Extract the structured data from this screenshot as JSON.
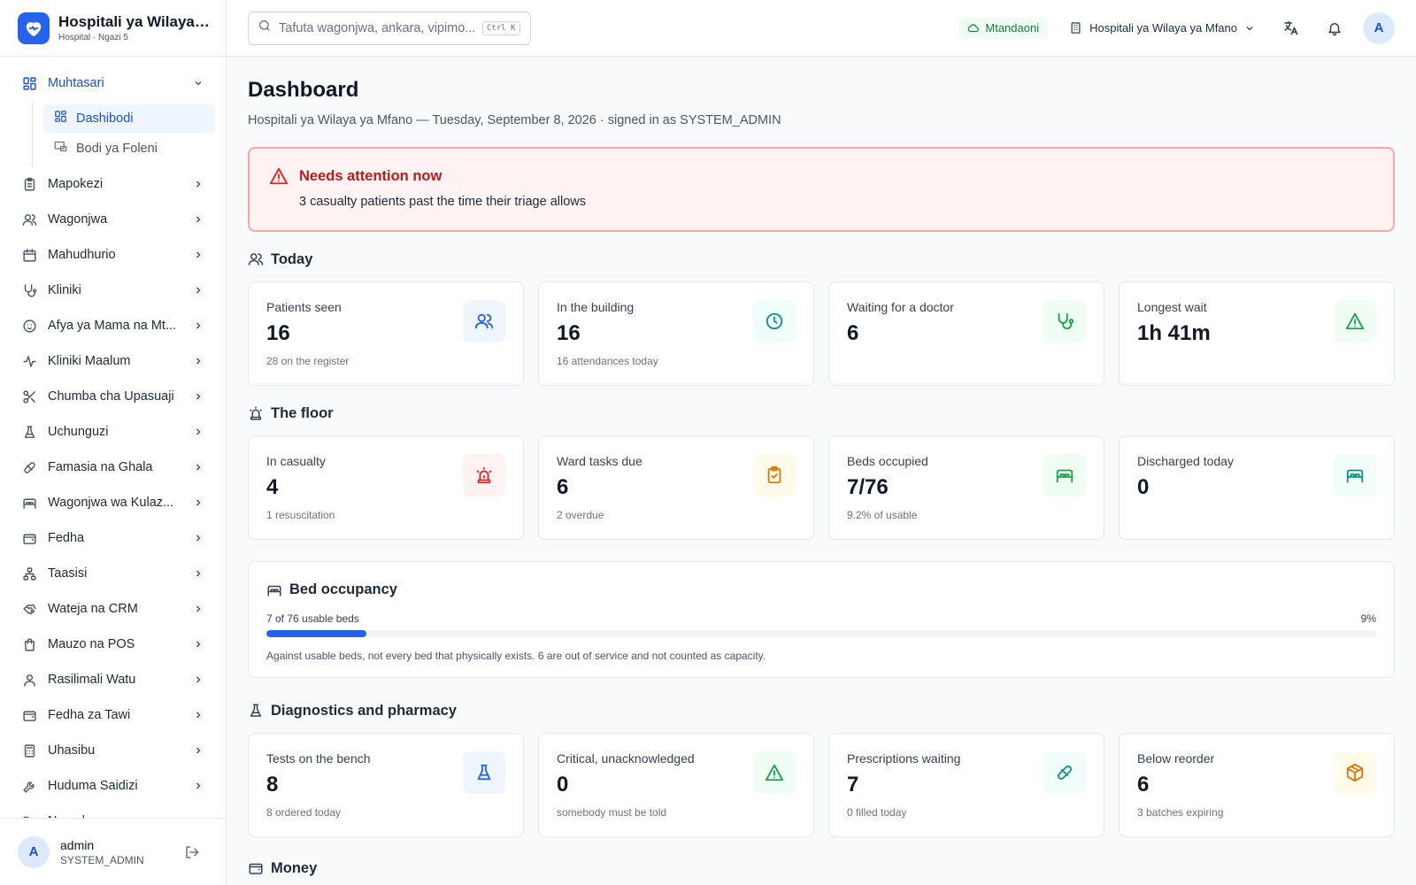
{
  "brand": {
    "name": "Hospitali ya Wilaya ...",
    "sub": "Hospital · Ngazi 5"
  },
  "nav": {
    "open_group": "Muhtasari",
    "sub_items": [
      {
        "label": "Dashibodi",
        "icon": "dashboard-icon"
      },
      {
        "label": "Bodi ya Foleni",
        "icon": "queue-board-icon"
      }
    ],
    "items": [
      {
        "label": "Mapokezi",
        "icon": "clipboard-icon"
      },
      {
        "label": "Wagonjwa",
        "icon": "users-icon"
      },
      {
        "label": "Mahudhurio",
        "icon": "calendar-icon"
      },
      {
        "label": "Kliniki",
        "icon": "stethoscope-icon"
      },
      {
        "label": "Afya ya Mama na Mt...",
        "icon": "baby-icon"
      },
      {
        "label": "Kliniki Maalum",
        "icon": "activity-icon"
      },
      {
        "label": "Chumba cha Upasuaji",
        "icon": "scissors-icon"
      },
      {
        "label": "Uchunguzi",
        "icon": "flask-icon"
      },
      {
        "label": "Famasia na Ghala",
        "icon": "pill-icon"
      },
      {
        "label": "Wagonjwa wa Kulaz...",
        "icon": "bed-icon"
      },
      {
        "label": "Fedha",
        "icon": "wallet-icon"
      },
      {
        "label": "Taasisi",
        "icon": "org-icon"
      },
      {
        "label": "Wateja na CRM",
        "icon": "handshake-icon"
      },
      {
        "label": "Mauzo na POS",
        "icon": "shopping-bag-icon"
      },
      {
        "label": "Rasilimali Watu",
        "icon": "user-icon"
      },
      {
        "label": "Fedha za Tawi",
        "icon": "wallet-icon"
      },
      {
        "label": "Uhasibu",
        "icon": "calculator-icon"
      },
      {
        "label": "Huduma Saidizi",
        "icon": "wrench-icon"
      },
      {
        "label": "Nyaraka",
        "icon": "folder-icon"
      }
    ]
  },
  "user": {
    "initial": "A",
    "name": "admin",
    "role": "SYSTEM_ADMIN"
  },
  "topbar": {
    "search_placeholder": "Tafuta wagonjwa, ankara, vipimo...",
    "shortcut": "Ctrl K",
    "status": "Mtandaoni",
    "facility": "Hospitali ya Wilaya ya Mfano",
    "avatar_initial": "A"
  },
  "page": {
    "title": "Dashboard",
    "subtitle": "Hospitali ya Wilaya ya Mfano — Tuesday, September 8, 2026 · signed in as SYSTEM_ADMIN"
  },
  "alert": {
    "title": "Needs attention now",
    "text": "3 casualty patients past the time their triage allows"
  },
  "sections": {
    "today": {
      "title": "Today",
      "cards": [
        {
          "label": "Patients seen",
          "value": "16",
          "note": "28 on the register",
          "icon": "users-icon",
          "color": "#2563eb",
          "bg": "#eff6ff"
        },
        {
          "label": "In the building",
          "value": "16",
          "note": "16 attendances today",
          "icon": "clock-icon",
          "color": "#0d9488",
          "bg": "#f0fdfa"
        },
        {
          "label": "Waiting for a doctor",
          "value": "6",
          "note": "",
          "icon": "stethoscope-icon",
          "color": "#16a34a",
          "bg": "#f0fdf4"
        },
        {
          "label": "Longest wait",
          "value": "1h 41m",
          "note": "",
          "icon": "warning-icon",
          "color": "#16a34a",
          "bg": "#f0fdf4"
        }
      ]
    },
    "floor": {
      "title": "The floor",
      "cards": [
        {
          "label": "In casualty",
          "value": "4",
          "note": "1 resuscitation",
          "icon": "siren-icon",
          "color": "#dc2626",
          "bg": "#fef2f2"
        },
        {
          "label": "Ward tasks due",
          "value": "6",
          "note": "2 overdue",
          "icon": "clipboard-check-icon",
          "color": "#d97706",
          "bg": "#fffbeb"
        },
        {
          "label": "Beds occupied",
          "value": "7/76",
          "note": "9.2% of usable",
          "icon": "bed-icon",
          "color": "#16a34a",
          "bg": "#f0fdf4"
        },
        {
          "label": "Discharged today",
          "value": "0",
          "note": "",
          "icon": "bed-icon",
          "color": "#0d9488",
          "bg": "#f0fdfa"
        }
      ]
    },
    "bed_occupancy": {
      "title": "Bed occupancy",
      "usable_text": "7 of 76 usable beds",
      "percent_text": "9%",
      "percent": 9,
      "note": "Against usable beds, not every bed that physically exists. 6 are out of service and not counted as capacity."
    },
    "diagnostics": {
      "title": "Diagnostics and pharmacy",
      "cards": [
        {
          "label": "Tests on the bench",
          "value": "8",
          "note": "8 ordered today",
          "icon": "flask-icon",
          "color": "#2563eb",
          "bg": "#eff6ff"
        },
        {
          "label": "Critical, unacknowledged",
          "value": "0",
          "note": "somebody must be told",
          "icon": "warning-icon",
          "color": "#16a34a",
          "bg": "#f0fdf4"
        },
        {
          "label": "Prescriptions waiting",
          "value": "7",
          "note": "0 filled today",
          "icon": "pill-icon",
          "color": "#0d9488",
          "bg": "#f0fdfa"
        },
        {
          "label": "Below reorder",
          "value": "6",
          "note": "3 batches expiring",
          "icon": "box-icon",
          "color": "#d97706",
          "bg": "#fffbeb"
        }
      ]
    },
    "money": {
      "title": "Money"
    }
  }
}
